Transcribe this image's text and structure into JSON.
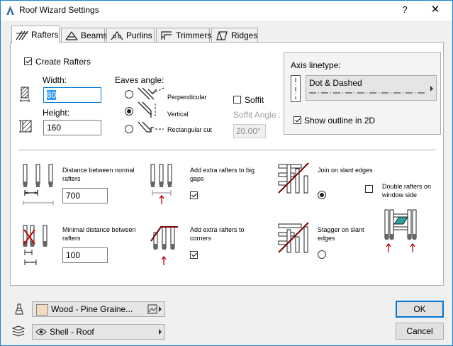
{
  "window": {
    "title": "Roof Wizard Settings",
    "help": "?",
    "close": "✕"
  },
  "tabs": [
    {
      "label": "Rafters"
    },
    {
      "label": "Beams"
    },
    {
      "label": "Purlins"
    },
    {
      "label": "Trimmers"
    },
    {
      "label": "Ridges"
    }
  ],
  "rafters": {
    "create_label": "Create Rafters",
    "create_checked": true,
    "width_label": "Width:",
    "width_value": "80",
    "height_label": "Height:",
    "height_value": "160",
    "eaves_label": "Eaves angle:",
    "eaves_options": [
      "Perpendicular",
      "Vertical",
      "Rectangular cut"
    ],
    "eaves_selected": "Vertical",
    "soffit_label": "Soffit",
    "soffit_angle_label": "Soffit Angle :",
    "soffit_angle_value": "20.00°",
    "axis_linetype_label": "Axis linetype:",
    "axis_linetype_value": "Dot & Dashed",
    "show_outline_label": "Show outline in 2D",
    "distance_normal_label": "Distance between normal rafters",
    "distance_normal_value": "700",
    "min_distance_label": "Minimal distance between rafters",
    "min_distance_value": "100",
    "add_big_gaps_label": "Add extra rafters to big gaps",
    "add_corners_label": "Add extra rafters to corners",
    "join_slant_label": "Join on slant edges",
    "stagger_slant_label": "Stagger on slant edges",
    "double_window_label": "Double rafters on window side"
  },
  "bottom": {
    "material_value": "Wood - Pine Graine...",
    "layer_value": "Shell - Roof",
    "ok_label": "OK",
    "cancel_label": "Cancel"
  },
  "colors": {
    "accent": "#0078d7",
    "red_arrow": "#c00000",
    "window_fill": "#2e9e9e",
    "material_swatch": "#f1dcc0"
  }
}
